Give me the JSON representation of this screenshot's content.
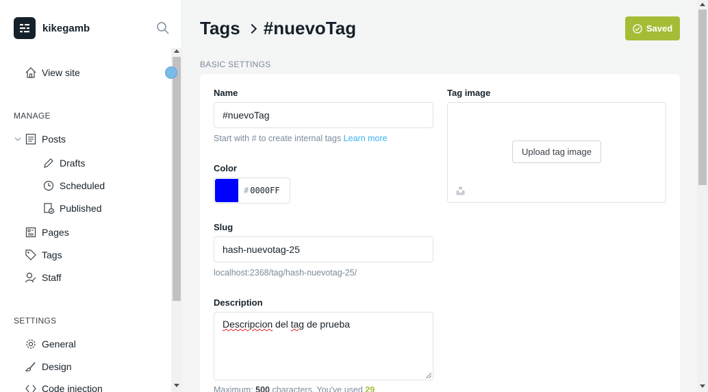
{
  "sidebar": {
    "site_name": "kikegamb",
    "view_site": "View site",
    "manage_heading": "MANAGE",
    "settings_heading": "SETTINGS",
    "items": {
      "posts": "Posts",
      "drafts": "Drafts",
      "scheduled": "Scheduled",
      "published": "Published",
      "pages": "Pages",
      "tags": "Tags",
      "staff": "Staff",
      "general": "General",
      "design": "Design",
      "code_injection": "Code injection"
    }
  },
  "header": {
    "breadcrumb_root": "Tags",
    "breadcrumb_current": "#nuevoTag",
    "saved_label": "Saved"
  },
  "section_label": "BASIC SETTINGS",
  "form": {
    "name_label": "Name",
    "name_value": "#nuevoTag",
    "name_hint": "Start with # to create internal tags",
    "name_hint_link": "Learn more",
    "color_label": "Color",
    "color_value": "0000FF",
    "color_hash": "#",
    "color_hex": "#0000FF",
    "slug_label": "Slug",
    "slug_value": "hash-nuevotag-25",
    "slug_url": "localhost:2368/tag/hash-nuevotag-25/",
    "description_label": "Description",
    "description_word1": "Descripcion",
    "description_mid": " del ",
    "description_word2": "tag",
    "description_end": " de prueba",
    "desc_max_prefix": "Maximum: ",
    "desc_max": "500",
    "desc_used_prefix": " characters. You've used ",
    "desc_used": "29",
    "tag_image_label": "Tag image",
    "upload_label": "Upload tag image"
  },
  "colors": {
    "accent_green": "#a4bd37",
    "link_blue": "#3eb0ef",
    "swatch": "#0000FF"
  }
}
